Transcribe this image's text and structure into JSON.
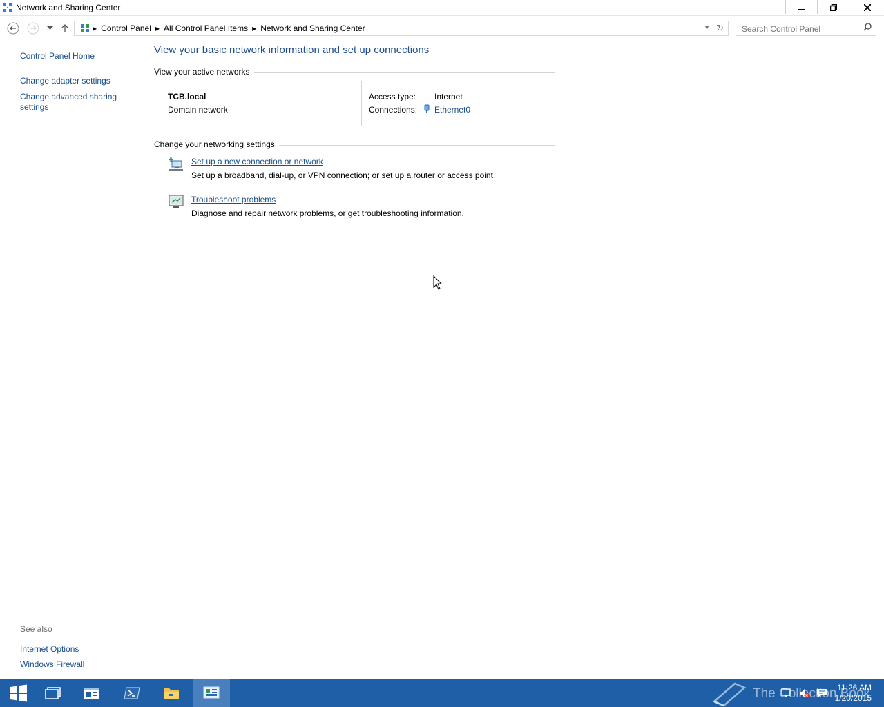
{
  "window": {
    "title": "Network and Sharing Center",
    "controls": {
      "minimize": "minimize-icon",
      "maximize": "restore-icon",
      "close": "close-icon"
    }
  },
  "nav": {
    "back": "back-arrow-icon",
    "forward": "forward-arrow-icon",
    "history": "dropdown-icon",
    "up": "up-arrow-icon",
    "breadcrumbs": [
      "Control Panel",
      "All Control Panel Items",
      "Network and Sharing Center"
    ],
    "search_placeholder": "Search Control Panel"
  },
  "left_pane": {
    "home": "Control Panel Home",
    "adapter": "Change adapter settings",
    "advanced": "Change advanced sharing settings",
    "see_also": "See also",
    "internet_options": "Internet Options",
    "firewall": "Windows Firewall"
  },
  "main": {
    "heading": "View your basic network information and set up connections",
    "active_networks_header": "View your active networks",
    "network": {
      "name": "TCB.local",
      "type": "Domain network",
      "access_type_label": "Access type:",
      "access_type_value": "Internet",
      "connections_label": "Connections:",
      "connection_value": "Ethernet0"
    },
    "change_header": "Change your networking settings",
    "tasks": [
      {
        "title": "Set up a new connection or network",
        "desc": "Set up a broadband, dial-up, or VPN connection; or set up a router or access point."
      },
      {
        "title": "Troubleshoot problems",
        "desc": "Diagnose and repair network problems, or get troubleshooting information."
      }
    ]
  },
  "taskbar": {
    "apps": [
      "start-icon",
      "task-view-icon",
      "server-manager-icon",
      "powershell-icon",
      "file-explorer-icon",
      "control-panel-icon"
    ],
    "watermark": "The Collection Book",
    "time": "11:26 AM",
    "date": "1/20/2015"
  },
  "colors": {
    "link": "#1a4f8c",
    "heading": "#1e4e8c",
    "taskbar": "#1e5fa8"
  }
}
